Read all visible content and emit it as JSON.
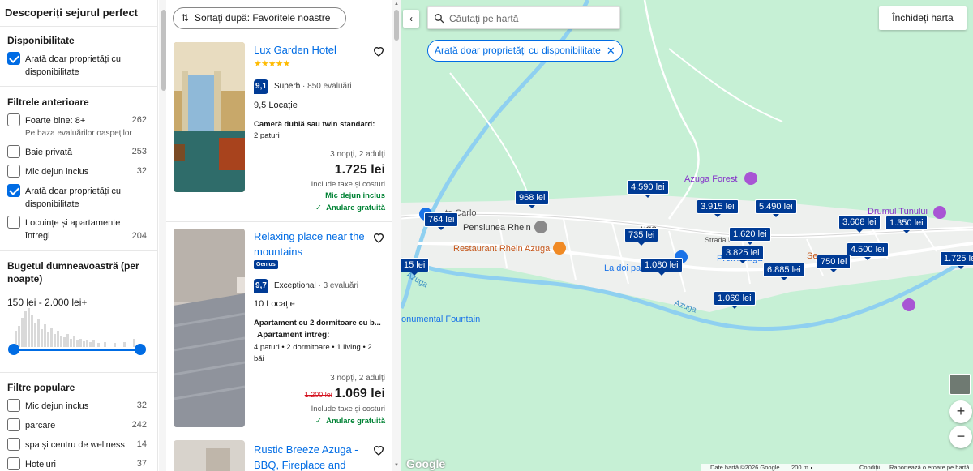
{
  "filters": {
    "title": "Descoperiți sejurul perfect",
    "availability": {
      "heading": "Disponibilitate",
      "option": "Arată doar proprietăți cu disponibilitate",
      "checked": true
    },
    "previous": {
      "heading": "Filtrele anterioare",
      "items": [
        {
          "label": "Foarte bine: 8+",
          "sub": "Pe baza evaluărilor oaspeților",
          "count": "262",
          "checked": false
        },
        {
          "label": "Baie privată",
          "sub": "",
          "count": "253",
          "checked": false
        },
        {
          "label": "Mic dejun inclus",
          "sub": "",
          "count": "32",
          "checked": false
        },
        {
          "label": "Arată doar proprietăți cu disponibilitate",
          "sub": "",
          "count": "",
          "checked": true
        },
        {
          "label": "Locuințe și apartamente întregi",
          "sub": "",
          "count": "204",
          "checked": false
        }
      ]
    },
    "budget": {
      "heading": "Bugetul dumneavoastră (per noapte)",
      "range": "150 lei - 2.000 lei+"
    },
    "popular": {
      "heading": "Filtre populare",
      "items": [
        {
          "label": "Mic dejun inclus",
          "count": "32",
          "checked": false
        },
        {
          "label": "parcare",
          "count": "242",
          "checked": false
        },
        {
          "label": "spa și centru de wellness",
          "count": "14",
          "checked": false
        },
        {
          "label": "Hoteluri",
          "count": "37",
          "checked": false
        }
      ]
    }
  },
  "results": {
    "sort_label": "Sortați după: Favoritele noastre",
    "cards": [
      {
        "name": "Lux Garden Hotel",
        "stars": "★★★★★",
        "score": "9,1",
        "score_word": "Superb",
        "reviews": "850 evaluări",
        "location": "9,5 Locație",
        "room": "Cameră dublă sau twin standard:",
        "room_sub": "2 paturi",
        "nights": "3 nopți, 2 adulți",
        "price": "1.725 lei",
        "tax": "Include taxe și costuri",
        "perk1": "Mic dejun inclus",
        "perk2": "Anulare gratuită"
      },
      {
        "name": "Relaxing place near the mountains",
        "badge": "Genius",
        "score": "9,7",
        "score_word": "Excepțional",
        "reviews": "3 evaluări",
        "location": "10 Locație",
        "room": "Apartament cu 2 dormitoare cu b...",
        "apt_head": "Apartament întreg:",
        "room_sub": "4 paturi • 2 dormitoare • 1 living • 2 băi",
        "nights": "3 nopți, 2 adulți",
        "old_price": "1.200 lei",
        "price": "1.069 lei",
        "tax": "Include taxe și costuri",
        "perk2": "Anulare gratuită"
      },
      {
        "name": "Rustic Breeze Azuga - BBQ, Fireplace and"
      }
    ]
  },
  "map": {
    "search_placeholder": "Căutați pe hartă",
    "avail_chip": "Arată doar proprietăți cu disponibilitate",
    "close_label": "Închideți harta",
    "prices": [
      "764 lei",
      "968 lei",
      "4.590 lei",
      "3.915 lei",
      "5.490 lei",
      "3.608 lei",
      "1.350 lei",
      "735 lei",
      "1.620 lei",
      "4.500 lei",
      "1.725 lei",
      "15 lei",
      "1.080 lei",
      "3.825 lei",
      "6.885 lei",
      "750 lei",
      "1.069 lei"
    ],
    "labels": {
      "azuga_forest": "Azuga Forest",
      "drumul": "Drumul Tunului",
      "carlo": "te Carlo",
      "pensiunea": "Pensiunea Rhein",
      "restaurant": "Restaurant Rhein Azuga",
      "doi": "La doi pa",
      "profi": "Profi Azuga",
      "strada": "Strada Florilo",
      "town": "uga",
      "azuga_river": "Azuga",
      "azuga_river2": "Azuga",
      "fountain": "onumental Fountain",
      "se": "Se"
    },
    "footer": {
      "data": "Date hartă ©2026 Google",
      "scale": "200 m",
      "terms": "Condiții",
      "report": "Raportează o eroare pe hartă"
    },
    "google": "Google"
  },
  "colors": {
    "brand": "#003b95",
    "link": "#006ce4",
    "green": "#008234",
    "map_bg": "#c6f0d5"
  }
}
